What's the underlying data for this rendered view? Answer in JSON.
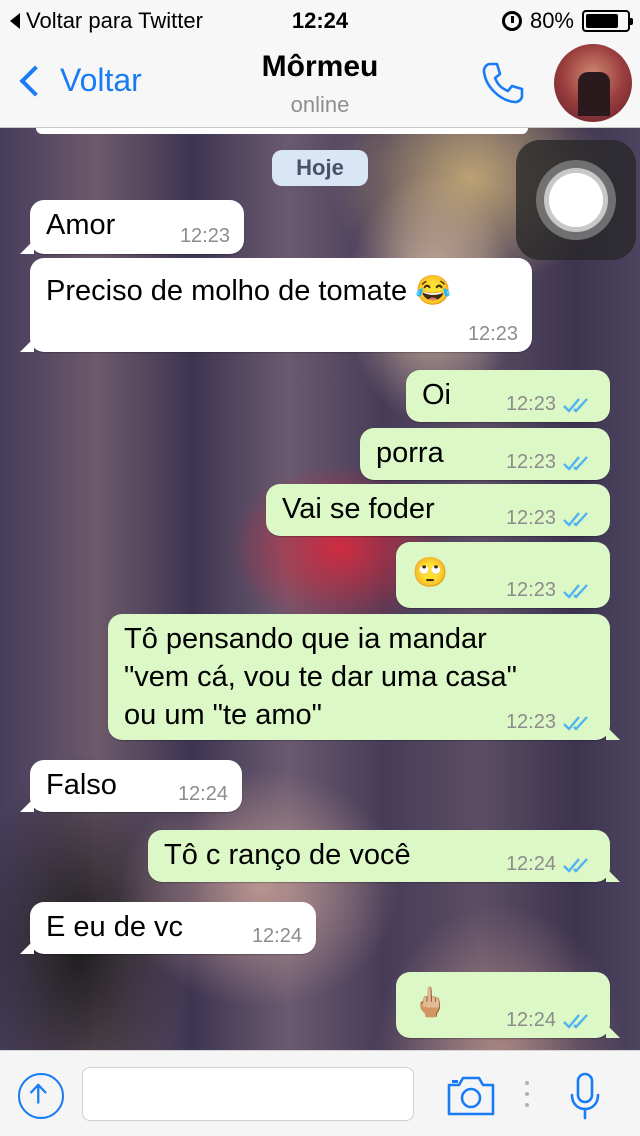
{
  "status_bar": {
    "back_app": "Voltar para Twitter",
    "time": "12:24",
    "battery_percent": "80%",
    "battery_level": 0.8
  },
  "nav": {
    "back_label": "Voltar",
    "contact_name": "Môrmeu",
    "presence": "online",
    "call_icon": "phone-icon",
    "avatar": "contact-avatar"
  },
  "chat": {
    "date_label": "Hoje",
    "messages": [
      {
        "direction": "in",
        "text": "Amor",
        "time": "12:23"
      },
      {
        "direction": "in",
        "text": "Preciso de molho de tomate 😂",
        "time": "12:23"
      },
      {
        "direction": "out",
        "text": "Oi",
        "time": "12:23",
        "status": "read"
      },
      {
        "direction": "out",
        "text": "porra",
        "time": "12:23",
        "status": "read"
      },
      {
        "direction": "out",
        "text": "Vai se foder",
        "time": "12:23",
        "status": "read"
      },
      {
        "direction": "out",
        "text": "🙄",
        "time": "12:23",
        "status": "read"
      },
      {
        "direction": "out",
        "text": "Tô pensando que ia mandar\n\"vem cá, vou te dar uma casa\"\nou um \"te amo\"",
        "time": "12:23",
        "status": "read"
      },
      {
        "direction": "in",
        "text": "Falso",
        "time": "12:24"
      },
      {
        "direction": "out",
        "text": "Tô c ranço de você",
        "time": "12:24",
        "status": "read"
      },
      {
        "direction": "in",
        "text": "E eu de vc",
        "time": "12:24"
      },
      {
        "direction": "out",
        "text": "🖕🏼",
        "time": "12:24",
        "status": "read"
      }
    ]
  },
  "input": {
    "placeholder": "",
    "value": ""
  },
  "colors": {
    "accent": "#1a7cf5",
    "bubble_in": "#ffffff",
    "bubble_out": "#dcf8c6",
    "ticks_read": "#4fb3f0"
  }
}
